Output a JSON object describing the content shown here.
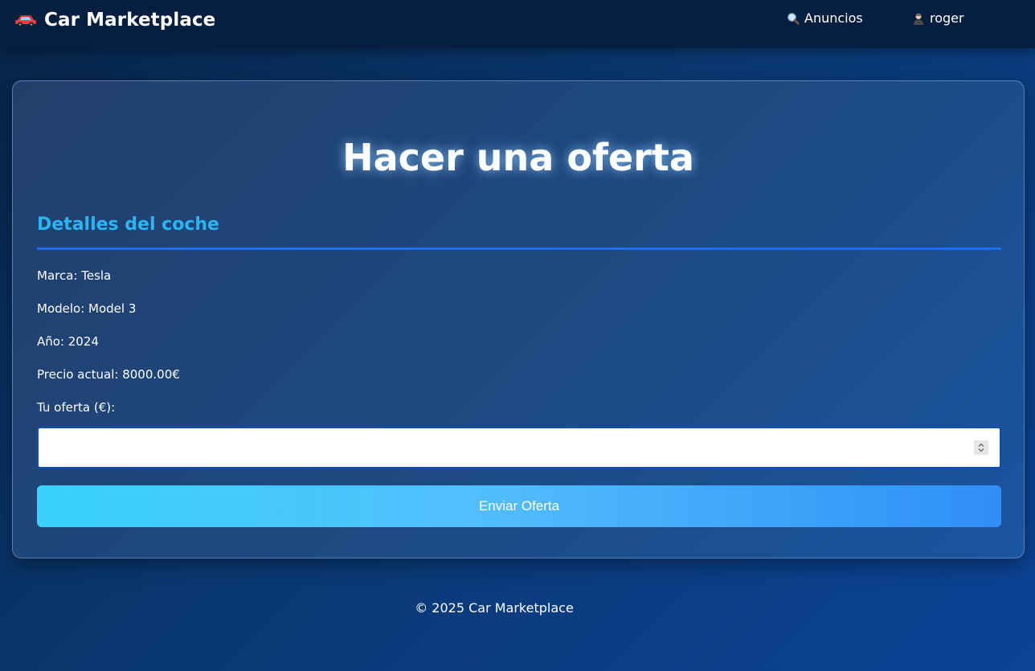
{
  "navbar": {
    "brand": "Car Marketplace",
    "brand_icon": "car-icon",
    "links": [
      {
        "label": "Anuncios",
        "icon": "search-icon"
      },
      {
        "label": "roger",
        "icon": "user-icon"
      }
    ]
  },
  "offer_form": {
    "title": "Hacer una oferta",
    "section_title": "Detalles del coche",
    "details": {
      "brand": "Marca: Tesla",
      "model": "Modelo: Model 3",
      "year": "Año: 2024",
      "current_price": "Precio actual: 8000.00€"
    },
    "offer_label": "Tu oferta (€):",
    "offer_value": "",
    "submit_label": "Enviar Oferta"
  },
  "footer": {
    "text": "© 2025 Car Marketplace"
  },
  "colors": {
    "accent": "#2ab4f2",
    "rule": "#1e6ef0",
    "button_start": "#38d2fc",
    "button_end": "#2f8ef7"
  }
}
